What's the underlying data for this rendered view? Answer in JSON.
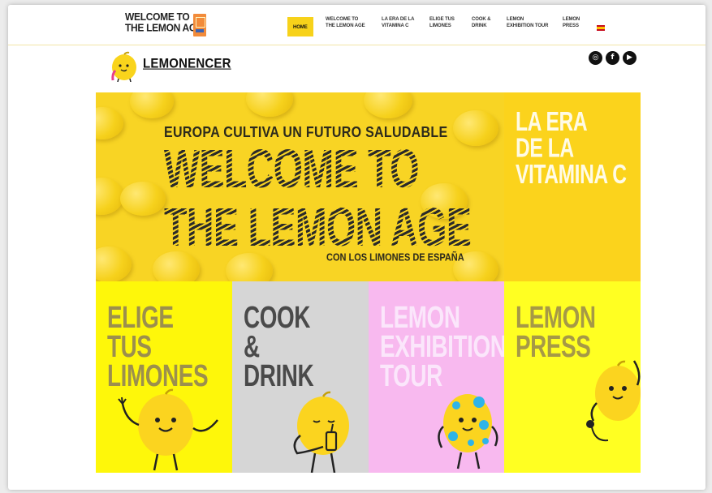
{
  "header": {
    "brand_title": "WELCOME TO\nTHE LEMON AGE",
    "nav": [
      {
        "label": "HOME",
        "active": true
      },
      {
        "label": "WELCOME TO\nTHE LEMON AGE",
        "active": false
      },
      {
        "label": "LA ERA DE LA\nVITAMINA C",
        "active": false
      },
      {
        "label": "ELIGE TUS\nLIMONES",
        "active": false
      },
      {
        "label": "COOK &\nDRINK",
        "active": false
      },
      {
        "label": "LEMON\nEXHIBITION TOUR",
        "active": false
      },
      {
        "label": "LEMON\nPRESS",
        "active": false
      }
    ],
    "language_flag": "spain-flag-icon"
  },
  "subheader": {
    "site_name": "LEMONENCER",
    "socials": [
      "instagram-icon",
      "facebook-icon",
      "youtube-icon"
    ]
  },
  "hero": {
    "kicker": "EUROPA CULTIVA UN FUTURO SALUDABLE",
    "title": "WELCOME TO\nTHE LEMON AGE",
    "subtitle": "CON LOS LIMONES DE ESPAÑA"
  },
  "tiles": {
    "vitamina": "LA ERA\nDE LA\nVITAMINA C",
    "elige": "ELIGE\nTUS\nLIMONES",
    "cook": "COOK\n&\nDRINK",
    "tour": "LEMON\nEXHIBITION\nTOUR",
    "press": "LEMON\nPRESS"
  },
  "colors": {
    "accent_yellow": "#f7d21a",
    "tile_elige": "#fef70a",
    "tile_cook": "#d6d6d6",
    "tile_tour": "#f8b9ef",
    "tile_press": "#ffff22"
  }
}
